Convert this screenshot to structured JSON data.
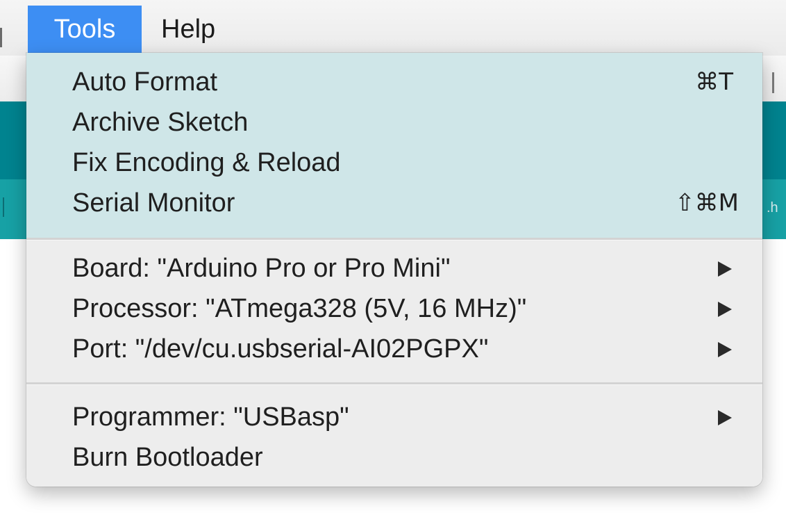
{
  "menubar": {
    "items": [
      {
        "label": "Tools"
      },
      {
        "label": "Help"
      }
    ]
  },
  "background": {
    "tab_text": ".h"
  },
  "tools_menu": {
    "items": [
      {
        "label": "Auto Format",
        "shortcut": "⌘T"
      },
      {
        "label": "Archive Sketch",
        "shortcut": ""
      },
      {
        "label": "Fix Encoding & Reload",
        "shortcut": ""
      },
      {
        "label": "Serial Monitor",
        "shortcut": "⇧⌘M"
      },
      {
        "label": "Board: \"Arduino Pro or Pro Mini\"",
        "submenu": true
      },
      {
        "label": "Processor: \"ATmega328 (5V, 16 MHz)\"",
        "submenu": true
      },
      {
        "label": "Port: \"/dev/cu.usbserial-AI02PGPX\"",
        "submenu": true
      },
      {
        "label": "Programmer: \"USBasp\"",
        "submenu": true
      },
      {
        "label": "Burn Bootloader",
        "submenu": false
      }
    ]
  },
  "colors": {
    "menubar_highlight": "#3d8ef3",
    "editor_header_teal": "#00838f",
    "editor_tab_teal": "#17a1a5"
  }
}
